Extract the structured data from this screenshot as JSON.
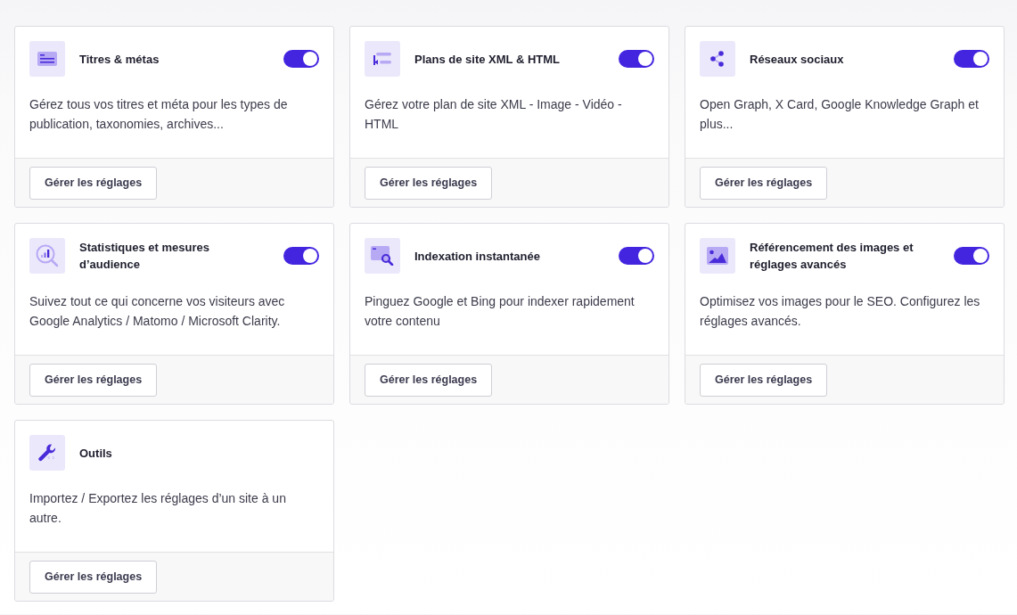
{
  "modules": [
    {
      "kind": "titles",
      "title": "Titres & métas",
      "on": true,
      "description": "Gérez tous vos titres et méta pour les types de publication, taxonomies, archives...",
      "button": "Gérer les réglages"
    },
    {
      "kind": "sitemap",
      "title": "Plans de site XML & HTML",
      "on": true,
      "description": "Gérez votre plan de site XML - Image - Vidéo - HTML",
      "button": "Gérer les réglages"
    },
    {
      "kind": "social",
      "title": "Réseaux sociaux",
      "on": true,
      "description": "Open Graph, X Card, Google Knowledge Graph et plus...",
      "button": "Gérer les réglages"
    },
    {
      "kind": "analytics",
      "title": "Statistiques et mesures d’audience",
      "on": true,
      "description": "Suivez tout ce qui concerne vos visiteurs avec Google Analytics / Matomo / Microsoft Clarity.",
      "button": "Gérer les réglages"
    },
    {
      "kind": "indexing",
      "title": "Indexation instantanée",
      "on": true,
      "description": "Pinguez Google et Bing pour indexer rapidement votre contenu",
      "button": "Gérer les réglages"
    },
    {
      "kind": "images",
      "title": "Référencement des images et réglages avancés",
      "on": true,
      "description": "Optimisez vos images pour le SEO. Configurez les réglages avancés.",
      "button": "Gérer les réglages"
    },
    {
      "kind": "tools",
      "title": "Outils",
      "description": "Importez / Exportez les réglages d’un site à un autre.",
      "button": "Gérer les réglages"
    }
  ]
}
